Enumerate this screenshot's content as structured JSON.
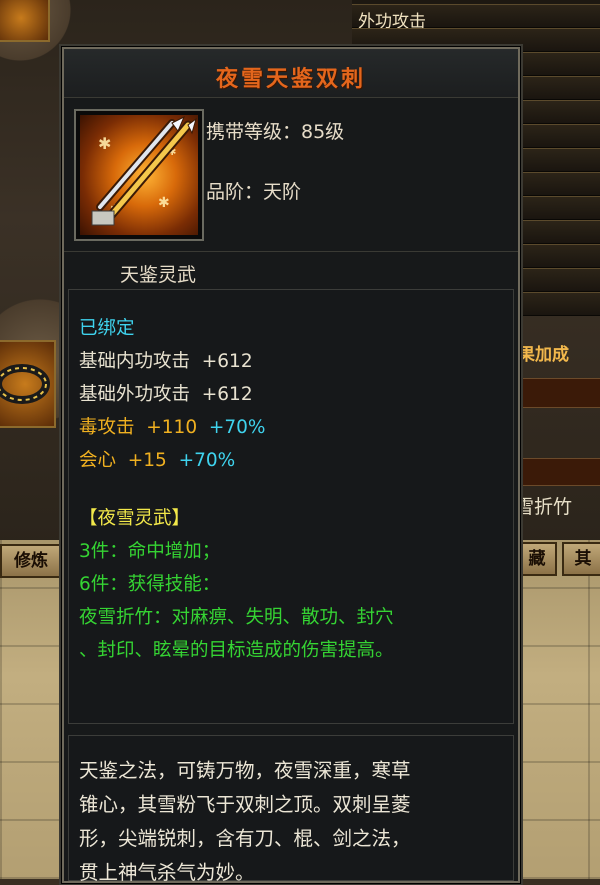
{
  "background": {
    "right_rows": [
      "外功攻击",
      "",
      "",
      "",
      "",
      "",
      "",
      "",
      "",
      "",
      "",
      "",
      ""
    ],
    "right_label": "果加成",
    "right_text": "雪折竹",
    "tabs": {
      "left": "修炼",
      "mid": "藏",
      "right": "其"
    }
  },
  "tooltip": {
    "title": "夜雪天鉴双刺",
    "carry_level_label": "携带等级：85级",
    "grade_label": "品阶：天阶",
    "subtitle": "天鉴灵武",
    "bound": "已绑定",
    "stats": [
      {
        "name": "基础内功攻击",
        "value": "+612",
        "extra": ""
      },
      {
        "name": "基础外功攻击",
        "value": "+612",
        "extra": ""
      },
      {
        "name": "毒攻击",
        "value": "+110",
        "extra": "+70%"
      },
      {
        "name": "会心",
        "value": "+15",
        "extra": "+70%"
      }
    ],
    "set_name": "【夜雪灵武】",
    "set_bonus_1": "3件：命中增加；",
    "set_bonus_2": "6件：获得技能：",
    "skill_line_1": "夜雪折竹：对麻痹、失明、散功、封穴",
    "skill_line_2": "、封印、眩晕的目标造成的伤害提高。",
    "description": [
      "天鉴之法，可铸万物，夜雪深重，寒草",
      "锥心，其雪粉飞于双刺之顶。双刺呈菱",
      "形，尖端锐刺，含有刀、棍、剑之法，",
      "贯上神气杀气为妙。"
    ]
  },
  "colors": {
    "title": "#e4661c",
    "bound": "#3fd3ee",
    "gold_stat": "#f0b020",
    "percent": "#3fd3ee",
    "set": "#f2e84a",
    "set_bonus": "#35d433"
  }
}
